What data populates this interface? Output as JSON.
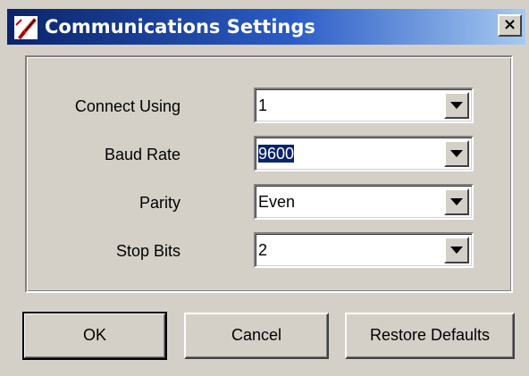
{
  "window": {
    "title": "Communications Settings",
    "close_label": "×",
    "title_icon": "app-brush-icon",
    "titlebar_colors": [
      "#0a246a",
      "#a6caf0"
    ]
  },
  "settings": [
    {
      "label": "Connect Using",
      "value": "1",
      "selected": false
    },
    {
      "label": "Baud Rate",
      "value": "9600",
      "selected": true
    },
    {
      "label": "Parity",
      "value": "Even",
      "selected": false
    },
    {
      "label": "Stop Bits",
      "value": "2",
      "selected": false
    }
  ],
  "buttons": {
    "ok": "OK",
    "cancel": "Cancel",
    "restore": "Restore Defaults"
  }
}
